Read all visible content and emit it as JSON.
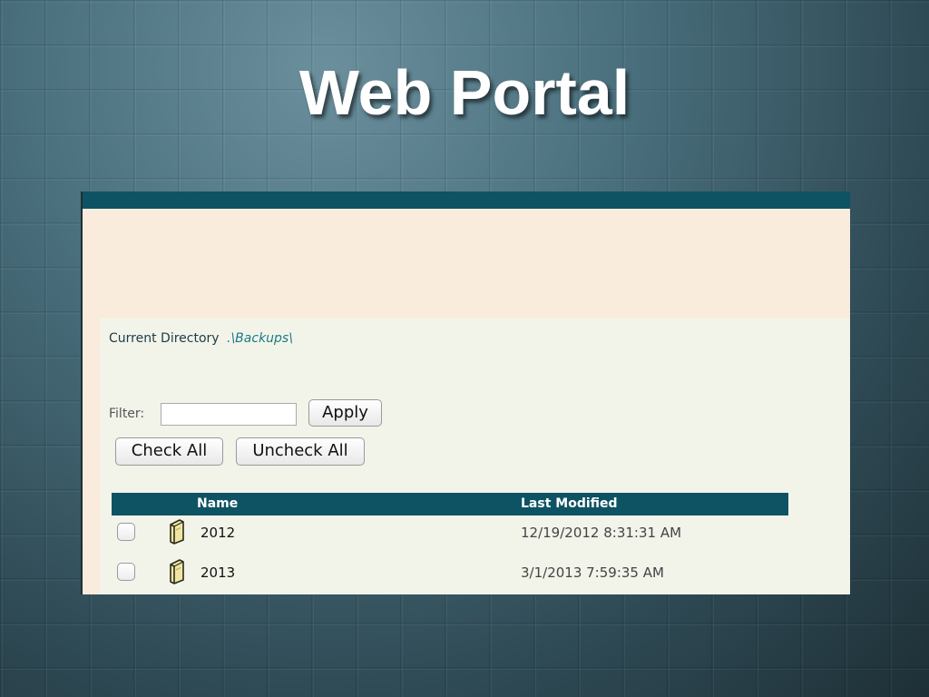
{
  "slide": {
    "title": "Web Portal"
  },
  "portal": {
    "current_directory": {
      "label": "Current Directory",
      "path": ".\\Backups\\"
    },
    "filter": {
      "label": "Filter:",
      "value": "",
      "apply_label": "Apply"
    },
    "buttons": {
      "check_all": "Check All",
      "uncheck_all": "Uncheck All"
    },
    "table": {
      "columns": {
        "name": "Name",
        "last_modified": "Last Modified"
      },
      "rows": [
        {
          "name": "2012",
          "last_modified": "12/19/2012 8:31:31 AM",
          "icon": "folder-icon",
          "checked": false
        },
        {
          "name": "2013",
          "last_modified": "3/1/2013 7:59:35 AM",
          "icon": "folder-icon",
          "checked": false
        }
      ]
    },
    "colors": {
      "header_bar": "#0e5363",
      "banner": "#f9ecdc",
      "body": "#f2f4ea",
      "path_link": "#1b7a87"
    }
  }
}
